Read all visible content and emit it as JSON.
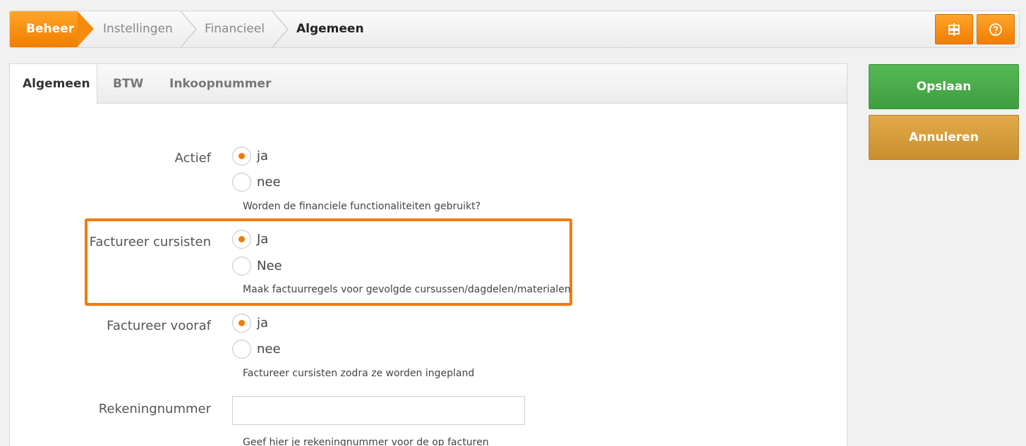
{
  "breadcrumb": {
    "home": "Beheer",
    "items": [
      "Instellingen",
      "Financieel"
    ],
    "current": "Algemeen"
  },
  "toolbar": {
    "icon_1": "signpost-icon",
    "icon_2": "help-icon"
  },
  "tabs": [
    "Algemeen",
    "BTW",
    "Inkoopnummer"
  ],
  "form": {
    "actief": {
      "label": "Actief",
      "options": [
        "ja",
        "nee"
      ],
      "selected": "ja",
      "help": "Worden de financiele functionaliteiten gebruikt?"
    },
    "factureer_cursisten": {
      "label": "Factureer cursisten",
      "options": [
        "Ja",
        "Nee"
      ],
      "selected": "Ja",
      "help": "Maak factuurregels voor gevolgde cursussen/dagdelen/materialen"
    },
    "factureer_vooraf": {
      "label": "Factureer vooraf",
      "options": [
        "ja",
        "nee"
      ],
      "selected": "ja",
      "help": "Factureer cursisten zodra ze worden ingepland"
    },
    "rekeningnummer": {
      "label": "Rekeningnummer",
      "value": "",
      "help": "Geef hier je rekeningnummer voor de op facturen"
    }
  },
  "actions": {
    "save": "Opslaan",
    "cancel": "Annuleren"
  },
  "colors": {
    "accent": "#f07d00",
    "save": "#4cae4c",
    "cancel": "#d49c3b",
    "highlight": "#f47a0c"
  }
}
